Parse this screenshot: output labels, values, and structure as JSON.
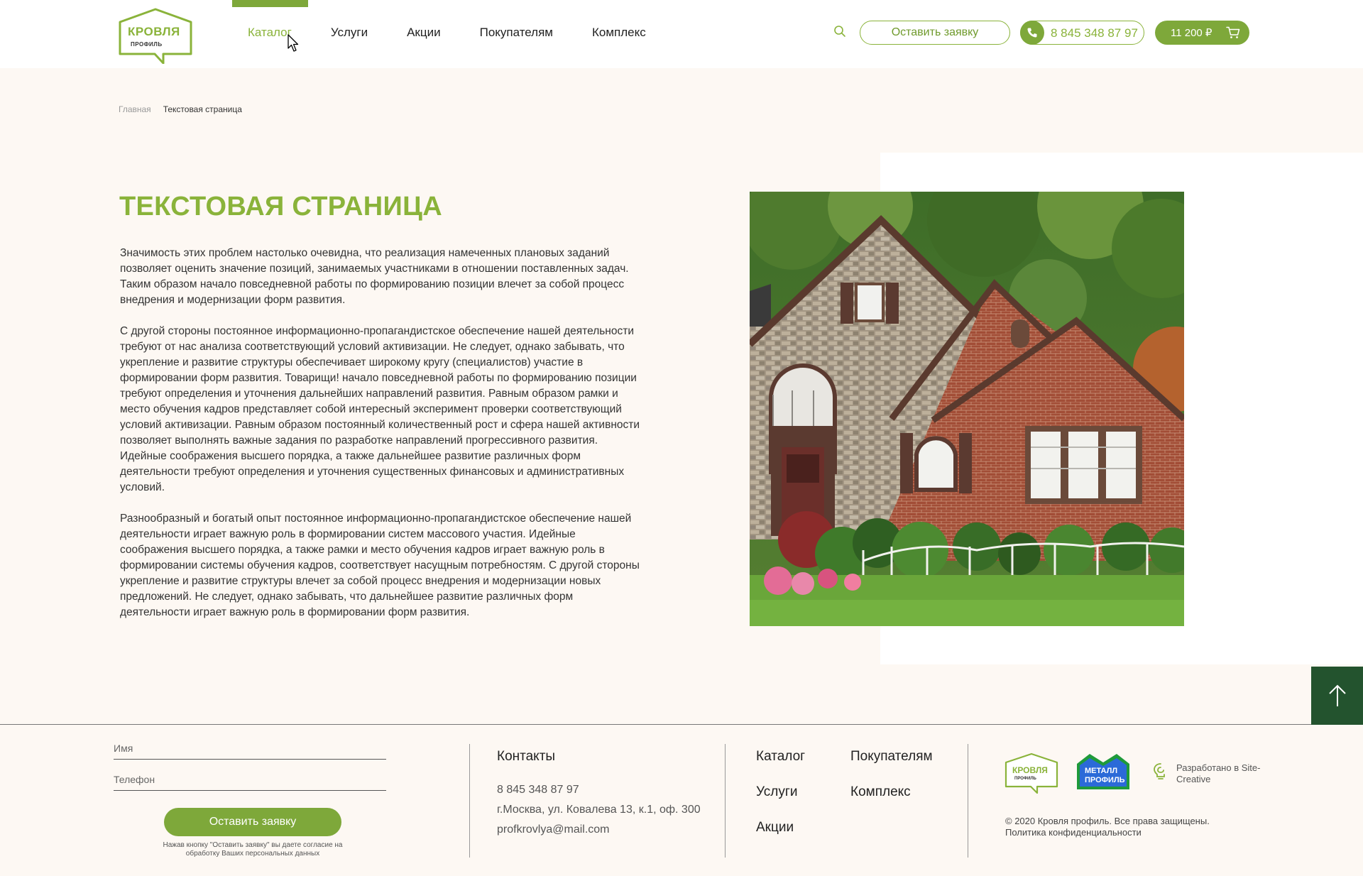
{
  "header": {
    "logo": {
      "main": "КРОВЛЯ",
      "sub": "ПРОФИЛЬ"
    },
    "nav": [
      "Каталог",
      "Услуги",
      "Акции",
      "Покупателям",
      "Комплекс"
    ],
    "active_nav": "Каталог",
    "request_button": "Оставить заявку",
    "phone": "8 845 348 87 97",
    "cart_sum": "11 200 ₽",
    "icons": {
      "search": "search-icon",
      "phone": "phone-icon",
      "cart": "cart-icon"
    }
  },
  "breadcrumb": {
    "home": "Главная",
    "current": "Текстовая страница"
  },
  "main": {
    "title": "ТЕКСТОВАЯ СТРАНИЦА",
    "paragraphs": [
      "Значимость этих проблем настолько очевидна, что реализация намеченных плановых заданий позволяет оценить значение позиций, занимаемых участниками в отношении поставленных задач. Таким образом начало повседневной работы по формированию позиции влечет за собой процесс внедрения и модернизации форм развития.",
      "С другой стороны постоянное информационно-пропагандистское обеспечение нашей деятельности требуют от нас анализа соответствующий условий активизации. Не следует, однако забывать, что укрепление и развитие структуры обеспечивает широкому кругу (специалистов) участие в формировании форм развития. Товарищи! начало повседневной работы по формированию позиции требуют определения и уточнения дальнейших направлений развития. Равным образом рамки и место обучения кадров представляет собой интересный эксперимент проверки соответствующий условий активизации. Равным образом постоянный количественный рост и сфера нашей активности позволяет выполнять важные задания по разработке направлений прогрессивного развития. Идейные соображения высшего порядка, а также дальнейшее развитие различных форм деятельности требуют определения и уточнения существенных финансовых и административных условий.",
      "Разнообразный и богатый опыт постоянное информационно-пропагандистское обеспечение нашей деятельности играет важную роль в формировании систем массового участия. Идейные соображения высшего порядка, а также рамки и место обучения кадров играет важную роль в формировании системы обучения кадров, соответствует насущным потребностям. С другой стороны укрепление и развитие структуры влечет за собой процесс внедрения и модернизации новых предложений. Не следует, однако забывать, что дальнейшее развитие различных форм деятельности играет важную роль в формировании форм развития."
    ],
    "image": "house-photo"
  },
  "scroll_top": {
    "icon": "arrow-up-icon"
  },
  "footer": {
    "form": {
      "name_placeholder": "Имя",
      "phone_placeholder": "Телефон",
      "submit": "Оставить заявку",
      "consent": "Нажав кнопку \"Оставить заявку\" вы даете согласие на обработку Ваших персональных данных"
    },
    "contacts": {
      "title": "Контакты",
      "phone": "8 845 348 87 97",
      "address": "г.Москва, ул. Ковалева 13, к.1, оф. 300",
      "email": "profkrovlya@mail.com"
    },
    "nav": [
      "Каталог",
      "Услуги",
      "Акции",
      "Покупателям",
      "Комплекс"
    ],
    "logos": {
      "krovlya": {
        "main": "КРОВЛЯ",
        "sub": "ПРОФИЛЬ"
      },
      "metall": {
        "line1": "МЕТАЛЛ",
        "line2": "ПРОФИЛЬ"
      }
    },
    "developer": "Разработано в Site-Creative",
    "copyright": "© 2020 Кровля профиль. Все права защищены.",
    "policy": "Политика конфиденциальности"
  },
  "colors": {
    "accent": "#8ab33a",
    "accent_dark": "#7ea83a",
    "dark_green": "#23532e",
    "page_bg": "#fdf8f3"
  }
}
